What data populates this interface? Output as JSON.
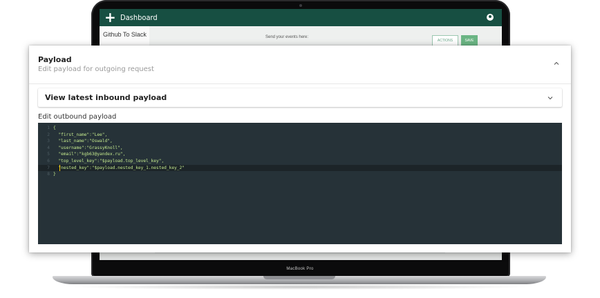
{
  "app": {
    "bar_title": "Dashboard",
    "tab_label": "Github To Slack",
    "send_text": "Send your events here:",
    "actions_label": "ACTIONS",
    "save_label": "SAVE"
  },
  "laptop": {
    "model_label": "MacBook Pro"
  },
  "panel": {
    "title": "Payload",
    "subtitle": "Edit payload for outgoing request",
    "accordion_label": "View latest inbound payload",
    "editor_label": "Edit outbound payload"
  },
  "editor": {
    "active_line": 7,
    "lines": [
      {
        "n": "1",
        "text": "{"
      },
      {
        "n": "2",
        "text": "  \"first_name\":\"Lee\","
      },
      {
        "n": "3",
        "text": "  \"last_name\":\"Oswald\","
      },
      {
        "n": "4",
        "text": "  \"username\":\"GrassyKnoll\","
      },
      {
        "n": "5",
        "text": "  \"email\":\"kgb63@yandex.ru\","
      },
      {
        "n": "6",
        "text": "  \"top_level_key\":\"$payload.top_level_key\","
      },
      {
        "n": "7",
        "text": "  \"nested_key\":\"$payload.nested_key_1.nested_key_2\""
      },
      {
        "n": "8",
        "text": "}"
      }
    ]
  },
  "colors": {
    "app_bar": "#174f42",
    "editor_bg": "#263238",
    "code_string": "#c3e88d",
    "save_button": "#6bb584"
  },
  "icons": {
    "add": "plus-icon",
    "account": "user-icon",
    "collapse": "chevron-up-icon",
    "expand": "chevron-down-icon"
  }
}
